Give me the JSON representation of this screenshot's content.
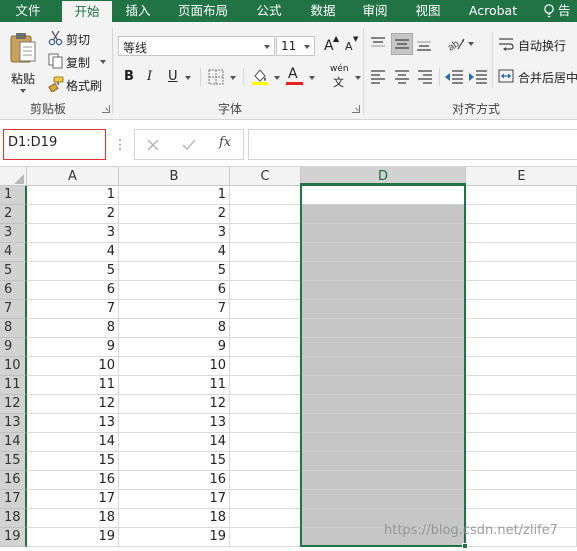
{
  "ribbon_tabs": [
    {
      "label": "文件",
      "active": false
    },
    {
      "label": "开始",
      "active": true
    },
    {
      "label": "插入",
      "active": false
    },
    {
      "label": "页面布局",
      "active": false
    },
    {
      "label": "公式",
      "active": false
    },
    {
      "label": "数据",
      "active": false
    },
    {
      "label": "审阅",
      "active": false
    },
    {
      "label": "视图",
      "active": false
    },
    {
      "label": "Acrobat",
      "active": false
    },
    {
      "label": "告",
      "active": false
    }
  ],
  "clipboard": {
    "paste_label": "粘贴",
    "cut_label": "剪切",
    "copy_label": "复制",
    "format_painter_label": "格式刷",
    "group_label": "剪贴板"
  },
  "font": {
    "font_name": "等线",
    "font_size": "11",
    "bold": "B",
    "italic": "I",
    "underline": "U",
    "group_label": "字体",
    "phonetic_label": "wén",
    "phonetic_char": "文",
    "highlight_color": "#ffff00",
    "font_color": "#e8211d"
  },
  "alignment": {
    "wrap_text_label": "自动换行",
    "merge_center_label": "合并后居中",
    "group_label": "对齐方式"
  },
  "formula_bar": {
    "name_box": "D1:D19",
    "fx_label": "fx",
    "formula": ""
  },
  "grid": {
    "columns": [
      "A",
      "B",
      "C",
      "D",
      "E"
    ],
    "selected_column": "D",
    "selected_range": "D1:D19",
    "rows": [
      {
        "num": "1",
        "a": "1",
        "b": "1"
      },
      {
        "num": "2",
        "a": "2",
        "b": "2"
      },
      {
        "num": "3",
        "a": "3",
        "b": "3"
      },
      {
        "num": "4",
        "a": "4",
        "b": "4"
      },
      {
        "num": "5",
        "a": "5",
        "b": "5"
      },
      {
        "num": "6",
        "a": "6",
        "b": "6"
      },
      {
        "num": "7",
        "a": "7",
        "b": "7"
      },
      {
        "num": "8",
        "a": "8",
        "b": "8"
      },
      {
        "num": "9",
        "a": "9",
        "b": "9"
      },
      {
        "num": "10",
        "a": "10",
        "b": "10"
      },
      {
        "num": "11",
        "a": "11",
        "b": "11"
      },
      {
        "num": "12",
        "a": "12",
        "b": "12"
      },
      {
        "num": "13",
        "a": "13",
        "b": "13"
      },
      {
        "num": "14",
        "a": "14",
        "b": "14"
      },
      {
        "num": "15",
        "a": "15",
        "b": "15"
      },
      {
        "num": "16",
        "a": "16",
        "b": "16"
      },
      {
        "num": "17",
        "a": "17",
        "b": "17"
      },
      {
        "num": "18",
        "a": "18",
        "b": "18"
      },
      {
        "num": "19",
        "a": "19",
        "b": "19"
      }
    ]
  },
  "watermark": "https://blog.csdn.net/zlife7",
  "colors": {
    "excel_green": "#217346",
    "selection_fill": "#c6c6c6",
    "name_box_highlight": "#e0302f"
  }
}
